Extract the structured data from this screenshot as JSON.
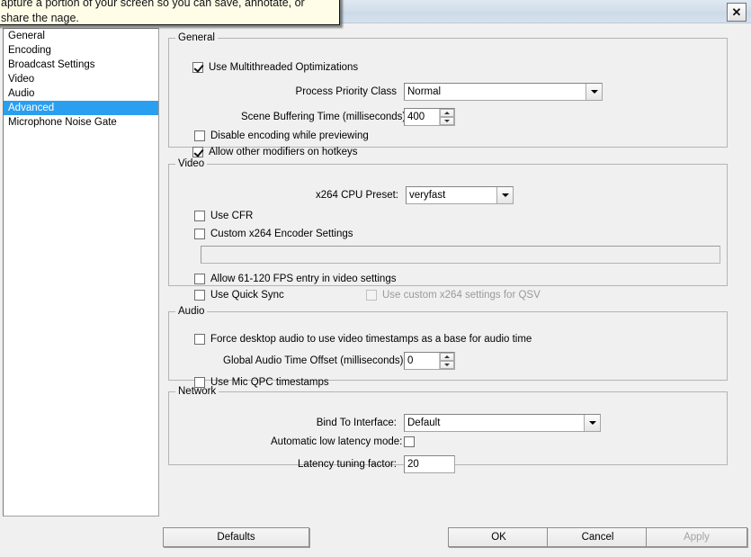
{
  "window": {
    "title": "",
    "close_label": "✕"
  },
  "tooltip": {
    "text": "apture a portion of your screen so you can save, annotate, or share the nage."
  },
  "sidebar": {
    "items": [
      {
        "label": "General",
        "selected": false
      },
      {
        "label": "Encoding",
        "selected": false
      },
      {
        "label": "Broadcast Settings",
        "selected": false
      },
      {
        "label": "Video",
        "selected": false
      },
      {
        "label": "Audio",
        "selected": false
      },
      {
        "label": "Advanced",
        "selected": true
      },
      {
        "label": "Microphone Noise Gate",
        "selected": false
      }
    ],
    "selected_label": "Advanced",
    "selection_color": "#2a9ff0"
  },
  "groups": {
    "general": {
      "title": "General",
      "use_multithreaded_label": "Use Multithreaded Optimizations",
      "use_multithreaded_checked": true,
      "process_priority_label": "Process Priority Class",
      "process_priority_value": "Normal",
      "scene_buffering_label": "Scene Buffering Time (milliseconds):",
      "scene_buffering_value": "400",
      "disable_encoding_label": "Disable encoding while previewing",
      "disable_encoding_checked": false,
      "allow_modifiers_label": "Allow other modifiers on hotkeys",
      "allow_modifiers_checked": true
    },
    "video": {
      "title": "Video",
      "cpu_preset_label": "x264 CPU Preset:",
      "cpu_preset_value": "veryfast",
      "use_cfr_label": "Use CFR",
      "use_cfr_checked": false,
      "custom_encoder_label": "Custom x264 Encoder Settings",
      "custom_encoder_checked": false,
      "custom_encoder_value": "",
      "allow_fps_label": "Allow 61-120 FPS entry in video settings",
      "allow_fps_checked": false,
      "quick_sync_label": "Use Quick Sync",
      "quick_sync_checked": false,
      "qsv_custom_label": "Use custom x264 settings for QSV",
      "qsv_custom_checked": false,
      "qsv_custom_disabled": true
    },
    "audio": {
      "title": "Audio",
      "force_desktop_label": "Force desktop audio to use video timestamps as a base for audio time",
      "force_desktop_checked": false,
      "global_offset_label": "Global Audio Time Offset (milliseconds):",
      "global_offset_value": "0",
      "mic_qpc_label": "Use Mic QPC timestamps",
      "mic_qpc_checked": false
    },
    "network": {
      "title": "Network",
      "bind_interface_label": "Bind To Interface:",
      "bind_interface_value": "Default",
      "auto_latency_label": "Automatic low latency mode:",
      "auto_latency_checked": false,
      "latency_factor_label": "Latency tuning factor:",
      "latency_factor_value": "20"
    }
  },
  "footer": {
    "defaults_label": "Defaults",
    "ok_label": "OK",
    "cancel_label": "Cancel",
    "apply_label": "Apply",
    "apply_disabled": true
  }
}
